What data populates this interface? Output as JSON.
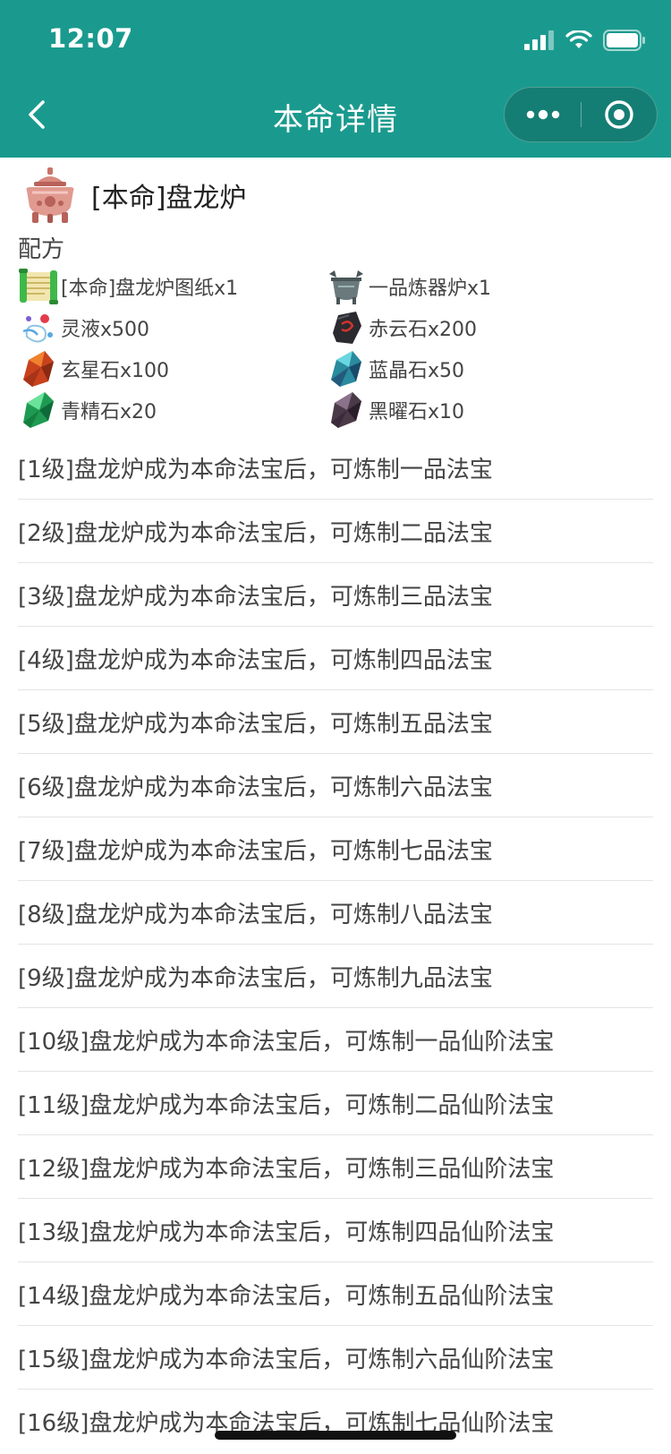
{
  "status_bar": {
    "time": "12:07"
  },
  "nav": {
    "title": "本命详情"
  },
  "item": {
    "name": "[本命]盘龙炉"
  },
  "recipe": {
    "label": "配方",
    "ingredients": [
      {
        "icon": "scroll-icon",
        "text": "[本命]盘龙炉图纸x1"
      },
      {
        "icon": "cauldron-icon",
        "text": "一品炼器炉x1"
      },
      {
        "icon": "spirit-liquid-icon",
        "text": "灵液x500"
      },
      {
        "icon": "red-cloud-stone-icon",
        "text": "赤云石x200"
      },
      {
        "icon": "dark-star-stone-icon",
        "text": "玄星石x100"
      },
      {
        "icon": "blue-crystal-icon",
        "text": "蓝晶石x50"
      },
      {
        "icon": "green-essence-stone-icon",
        "text": "青精石x20"
      },
      {
        "icon": "obsidian-icon",
        "text": "黑曜石x10"
      }
    ]
  },
  "levels": [
    "[1级]盘龙炉成为本命法宝后，可炼制一品法宝",
    "[2级]盘龙炉成为本命法宝后，可炼制二品法宝",
    "[3级]盘龙炉成为本命法宝后，可炼制三品法宝",
    "[4级]盘龙炉成为本命法宝后，可炼制四品法宝",
    "[5级]盘龙炉成为本命法宝后，可炼制五品法宝",
    "[6级]盘龙炉成为本命法宝后，可炼制六品法宝",
    "[7级]盘龙炉成为本命法宝后，可炼制七品法宝",
    "[8级]盘龙炉成为本命法宝后，可炼制八品法宝",
    "[9级]盘龙炉成为本命法宝后，可炼制九品法宝",
    "[10级]盘龙炉成为本命法宝后，可炼制一品仙阶法宝",
    "[11级]盘龙炉成为本命法宝后，可炼制二品仙阶法宝",
    "[12级]盘龙炉成为本命法宝后，可炼制三品仙阶法宝",
    "[13级]盘龙炉成为本命法宝后，可炼制四品仙阶法宝",
    "[14级]盘龙炉成为本命法宝后，可炼制五品仙阶法宝",
    "[15级]盘龙炉成为本命法宝后，可炼制六品仙阶法宝",
    "[16级]盘龙炉成为本命法宝后，可炼制七品仙阶法宝"
  ],
  "colors": {
    "header_bg": "#1a9a8e",
    "text": "#444444",
    "divider": "#e4e4e4"
  }
}
